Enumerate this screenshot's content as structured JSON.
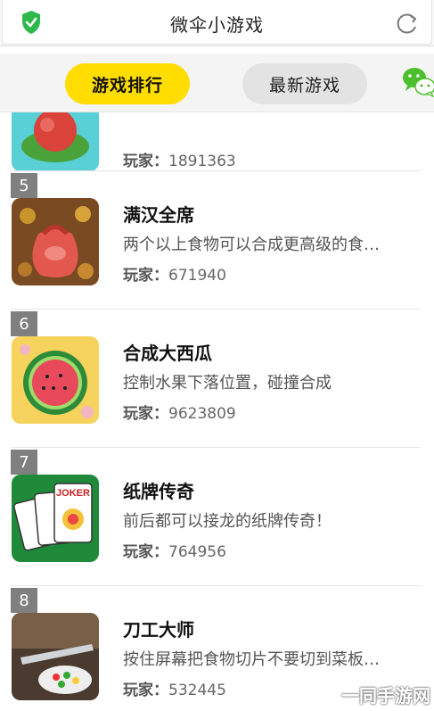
{
  "header": {
    "title": "微伞小游戏",
    "shield_icon": "shield-check-icon",
    "refresh_icon": "refresh-icon"
  },
  "tabs": [
    {
      "label": "游戏排行",
      "active": true
    },
    {
      "label": "最新游戏",
      "active": false
    }
  ],
  "share_icon": "wechat-icon",
  "players_prefix": "玩家：",
  "games": [
    {
      "rank": "",
      "name": "",
      "desc": "",
      "players": "1891363"
    },
    {
      "rank": "5",
      "name": "满汉全席",
      "desc": "两个以上食物可以合成更高级的食…",
      "players": "671940"
    },
    {
      "rank": "6",
      "name": "合成大西瓜",
      "desc": "控制水果下落位置，碰撞合成",
      "players": "9623809"
    },
    {
      "rank": "7",
      "name": "纸牌传奇",
      "desc": "前后都可以接龙的纸牌传奇！",
      "players": "764956"
    },
    {
      "rank": "8",
      "name": "刀工大师",
      "desc": "按住屏幕把食物切片不要切到菜板…",
      "players": "532445"
    }
  ],
  "watermark": "一同手游网",
  "colors": {
    "accent": "#ffdd00",
    "rank_badge": "#7f7f7f",
    "shield": "#2db84c"
  }
}
